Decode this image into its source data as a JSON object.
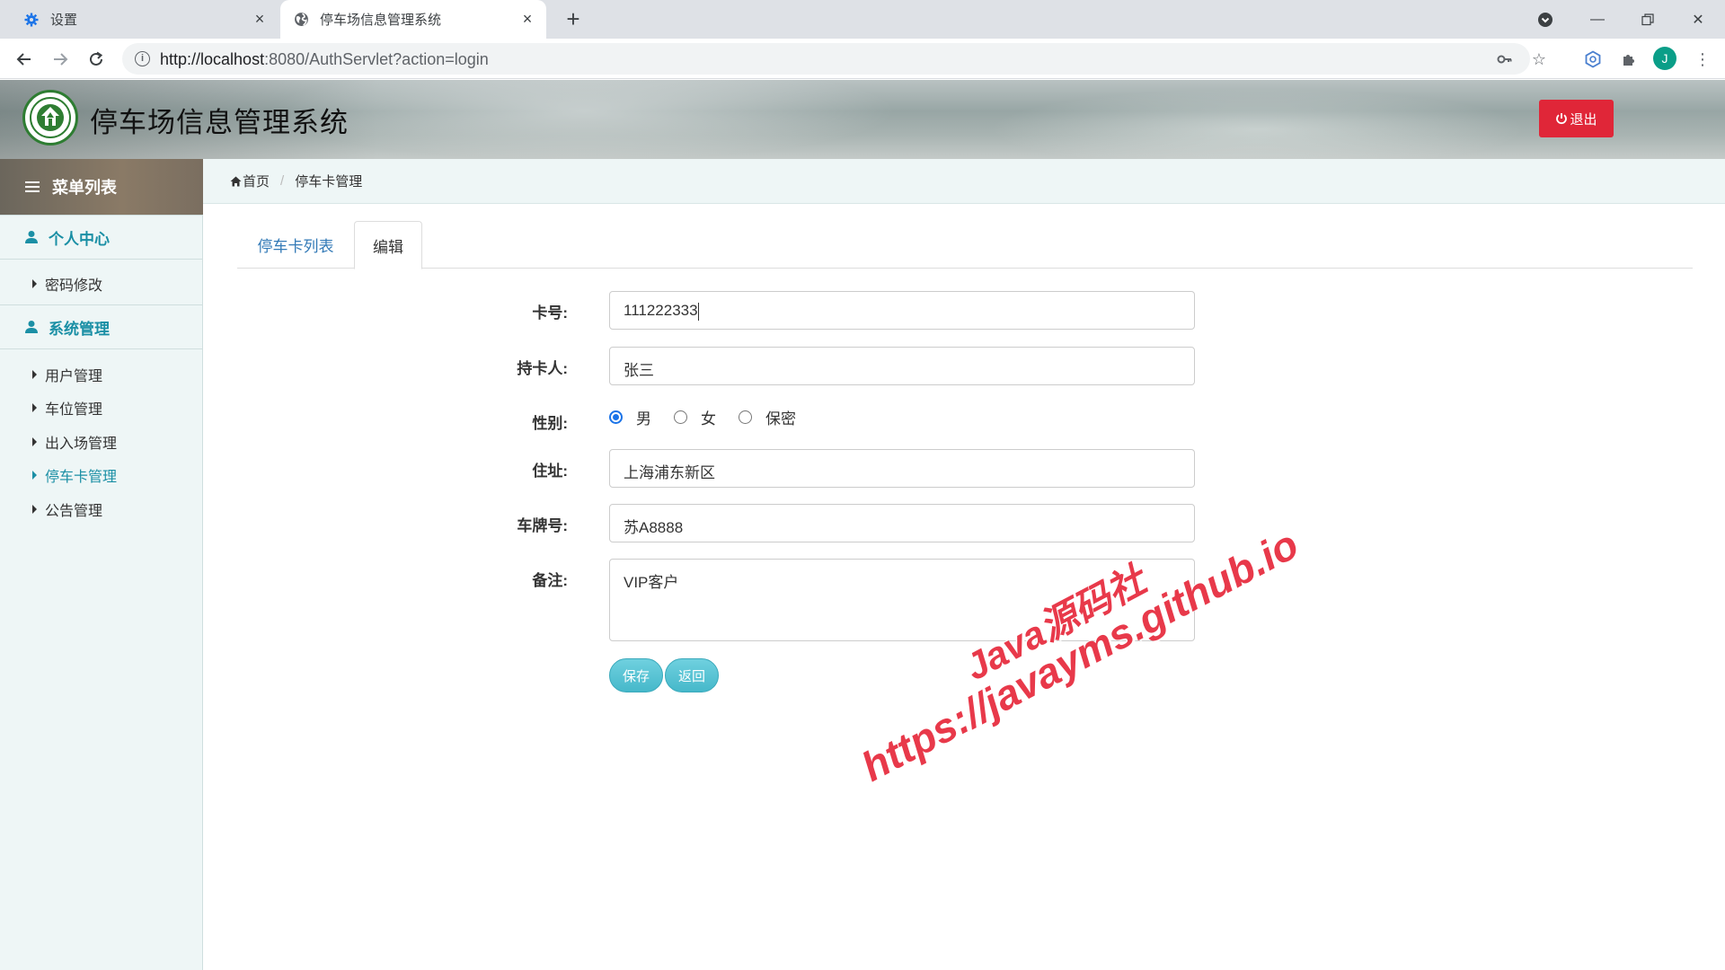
{
  "browser": {
    "tabs": [
      {
        "title": "设置",
        "icon": "gear-icon"
      },
      {
        "title": "停车场信息管理系统",
        "icon": "globe-icon"
      }
    ],
    "url_host": "http://localhost",
    "url_rest": ":8080/AuthServlet?action=login",
    "avatar_letter": "J"
  },
  "header": {
    "title": "停车场信息管理系统",
    "logout_label": "退出"
  },
  "sidebar": {
    "header": "菜单列表",
    "groups": [
      {
        "label": "个人中心",
        "items": [
          "密码修改"
        ]
      },
      {
        "label": "系统管理",
        "items": [
          "用户管理",
          "车位管理",
          "出入场管理",
          "停车卡管理",
          "公告管理"
        ]
      }
    ],
    "active_item": "停车卡管理"
  },
  "breadcrumb": {
    "home": "首页",
    "current": "停车卡管理"
  },
  "tabs": {
    "list": "停车卡列表",
    "edit": "编辑"
  },
  "form": {
    "card_no_label": "卡号:",
    "card_no_value": "111222333",
    "holder_label": "持卡人:",
    "holder_value": "张三",
    "gender_label": "性别:",
    "gender_options": [
      "男",
      "女",
      "保密"
    ],
    "gender_selected": "男",
    "address_label": "住址:",
    "address_value": "上海浦东新区",
    "plate_label": "车牌号:",
    "plate_value": "苏A8888",
    "remark_label": "备注:",
    "remark_value": "VIP客户",
    "save_label": "保存",
    "back_label": "返回"
  },
  "watermark": {
    "line1": "Java源码社",
    "line2": "https://javayms.github.io"
  },
  "colors": {
    "accent": "#1a8fa5",
    "logout_red": "#e02638",
    "button_teal": "#46b8ca",
    "watermark_red": "#e8394a"
  }
}
